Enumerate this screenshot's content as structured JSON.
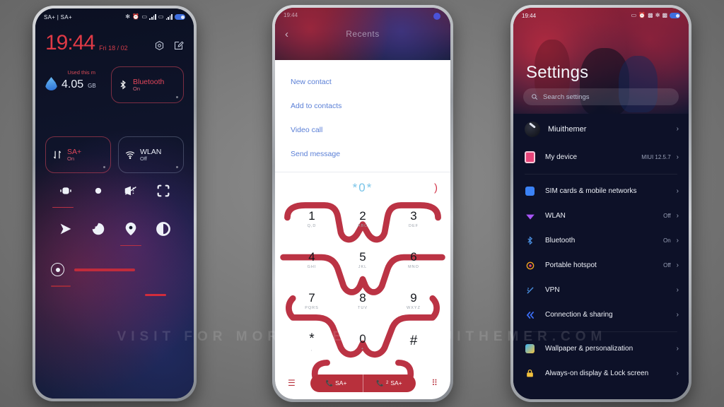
{
  "watermark": "VISIT FOR MORE THEMES • MIUITHEMER.COM",
  "control_center": {
    "status_bar": {
      "carrier": "SA+ | SA+",
      "icons": [
        "bluetooth-icon",
        "alarm-icon",
        "sim1-signal-icon",
        "sim2-signal-icon",
        "battery-icon"
      ]
    },
    "clock": "19:44",
    "date": "Fri 18 / 02",
    "actions": [
      "settings-gear-icon",
      "edit-icon"
    ],
    "data_card": {
      "label": "Used this m",
      "value": "4.05",
      "unit": "GB"
    },
    "tiles": [
      {
        "name": "Bluetooth",
        "state": "On",
        "icon": "bluetooth-icon",
        "active": true
      },
      {
        "name": "SA+",
        "state": "On",
        "icon": "mobile-data-icon",
        "active": true
      },
      {
        "name": "WLAN",
        "state": "Off",
        "icon": "wifi-icon",
        "active": false
      }
    ],
    "toggles": [
      {
        "icon": "vibrate-icon",
        "underline": true
      },
      {
        "icon": "dnd-icon",
        "underline": false
      },
      {
        "icon": "flashlight-off-icon",
        "underline": false
      },
      {
        "icon": "screenshot-icon",
        "underline": false
      },
      {
        "icon": "cast-icon",
        "underline": false
      },
      {
        "icon": "reading-mode-icon",
        "underline": false
      },
      {
        "icon": "location-icon",
        "underline": true
      },
      {
        "icon": "dark-mode-icon",
        "underline": false
      }
    ],
    "brightness": {
      "icon": "brightness-icon",
      "level": 45
    }
  },
  "dialer": {
    "header": {
      "title": "Recents",
      "back": "‹",
      "time": "19:44"
    },
    "menu": [
      "New contact",
      "Add to contacts",
      "Video call",
      "Send message"
    ],
    "number": "*0*",
    "delete_icon": "backspace-icon",
    "keys": [
      {
        "digit": "1",
        "letters": "Q,D"
      },
      {
        "digit": "2",
        "letters": "ABC"
      },
      {
        "digit": "3",
        "letters": "DEF"
      },
      {
        "digit": "4",
        "letters": "GHI"
      },
      {
        "digit": "5",
        "letters": "JKL"
      },
      {
        "digit": "6",
        "letters": "MNO"
      },
      {
        "digit": "7",
        "letters": "PQRS"
      },
      {
        "digit": "8",
        "letters": "TUV"
      },
      {
        "digit": "9",
        "letters": "WXYZ"
      },
      {
        "digit": "*",
        "letters": ","
      },
      {
        "digit": "0",
        "letters": "+"
      },
      {
        "digit": "#",
        "letters": ""
      }
    ],
    "call_buttons": [
      {
        "label": "SA+",
        "sim": "1",
        "icon": "call-icon"
      },
      {
        "label": "SA+",
        "sim": "2",
        "icon": "call-icon"
      }
    ],
    "bar_icons": [
      "menu-icon",
      "keypad-icon"
    ]
  },
  "settings": {
    "status_bar": {
      "time": "19:44"
    },
    "title": "Settings",
    "search_placeholder": "Search settings",
    "search_icon": "search-icon",
    "items": [
      {
        "label": "Miuithemer",
        "value": "",
        "icon": "account-avatar",
        "color": "#1d2130"
      },
      {
        "label": "My device",
        "value": "MIUI 12.5.7",
        "icon": "device-icon",
        "color": "#e8457a"
      },
      {
        "label": "SIM cards & mobile networks",
        "value": "",
        "icon": "sim-icon",
        "color": "#3b82f6"
      },
      {
        "label": "WLAN",
        "value": "Off",
        "icon": "wifi-icon",
        "color": "#a855f7"
      },
      {
        "label": "Bluetooth",
        "value": "On",
        "icon": "bluetooth-icon",
        "color": "#4a90e2"
      },
      {
        "label": "Portable hotspot",
        "value": "Off",
        "icon": "hotspot-icon",
        "color": "#f0a020"
      },
      {
        "label": "VPN",
        "value": "",
        "icon": "vpn-icon",
        "color": "#4a90e2"
      },
      {
        "label": "Connection & sharing",
        "value": "",
        "icon": "sharing-icon",
        "color": "#3b6ef6"
      },
      {
        "label": "Wallpaper & personalization",
        "value": "",
        "icon": "wallpaper-icon",
        "color": "#3bb2f6"
      },
      {
        "label": "Always-on display & Lock screen",
        "value": "",
        "icon": "lock-icon",
        "color": "#f2c13d"
      }
    ],
    "separators_after": [
      1,
      7
    ]
  },
  "colors": {
    "accent_red": "#e03a46",
    "dial_red": "#b8303c",
    "settings_bg": "#0d1128",
    "link_blue": "#5a7fd6"
  }
}
